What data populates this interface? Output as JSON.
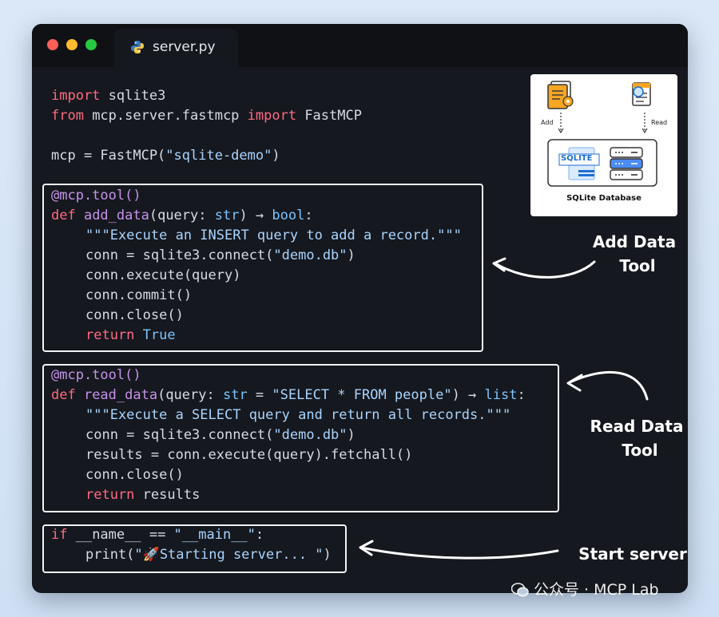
{
  "window": {
    "tab_title": "server.py",
    "traffic_lights": [
      "close",
      "minimize",
      "maximize"
    ]
  },
  "code": {
    "imports": [
      {
        "kw": "import",
        "rest": " sqlite3"
      },
      {
        "kw": "from",
        "mid": " mcp.server.fastmcp ",
        "kw2": "import",
        "rest": " FastMCP"
      }
    ],
    "mcp_line": {
      "lhs": "mcp = FastMCP(",
      "str": "\"sqlite-demo\"",
      "end": ")"
    },
    "add_tool": {
      "decorator": "@mcp.tool()",
      "def_kw": "def",
      "fn_name": " add_data",
      "sig_pre": "(query: ",
      "sig_type": "str",
      "sig_arrow": ") → ",
      "ret_type": "bool",
      "sig_end": ":",
      "docstring": "\"\"\"Execute an INSERT query to add a record.\"\"\"",
      "conn_pre": "conn = sqlite3.connect(",
      "conn_str": "\"demo.db\"",
      "conn_end": ")",
      "execute": "conn.execute(query)",
      "commit": "conn.commit()",
      "close": "conn.close()",
      "return_kw": "return",
      "return_val": " True"
    },
    "read_tool": {
      "decorator": "@mcp.tool()",
      "def_kw": "def",
      "fn_name": " read_data",
      "sig_pre": "(query: ",
      "sig_type": "str",
      "sig_eq": " = ",
      "sig_default": "\"SELECT * FROM people\"",
      "sig_arrow": ") → ",
      "ret_type": "list",
      "sig_end": ":",
      "docstring": "\"\"\"Execute a SELECT query and return all records.\"\"\"",
      "conn_pre": "conn = sqlite3.connect(",
      "conn_str": "\"demo.db\"",
      "conn_end": ")",
      "results": "results = conn.execute(query).fetchall()",
      "close": "conn.close()",
      "return_kw": "return",
      "return_val": " results"
    },
    "main_block": {
      "if_kw": "if",
      "cond_pre": " __name__ == ",
      "cond_str": "\"__main__\"",
      "cond_end": ":",
      "print_pre": "print(",
      "print_str": "\"🚀Starting server... \"",
      "print_end": ")"
    }
  },
  "diagram": {
    "add_label": "Add",
    "read_label": "Read",
    "sqlite_label": "SQLITE",
    "db_caption": "SQLite Database"
  },
  "annotations": {
    "add_data": [
      "Add Data",
      "Tool"
    ],
    "read_data": [
      "Read Data",
      "Tool"
    ],
    "start_server": "Start server"
  },
  "watermark": "公众号 · MCP Lab",
  "colors": {
    "keyword": "#ff6b81",
    "function": "#c792ea",
    "string": "#a9d4ff",
    "type": "#7cc4ff",
    "background": "#15181e"
  }
}
